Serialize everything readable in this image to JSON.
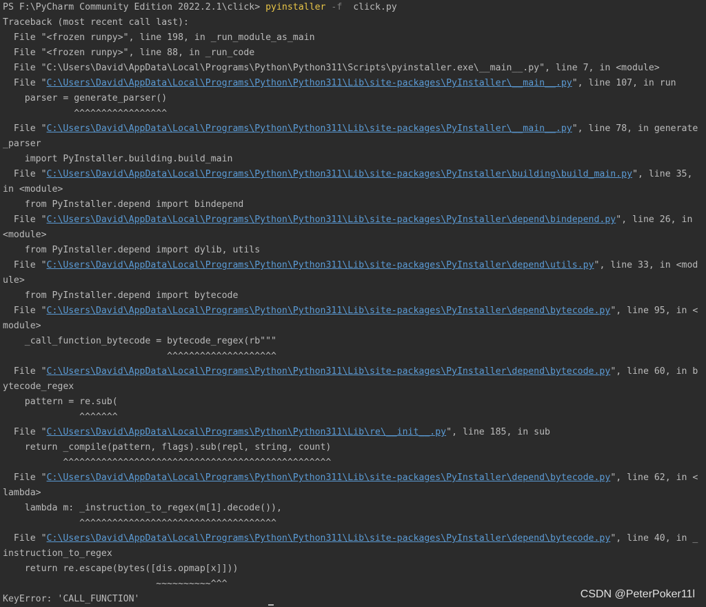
{
  "prompt": {
    "prefix": "PS F:\\PyCharm Community Edition 2022.2.1\\click> ",
    "command": "pyinstaller",
    "flag": "-f",
    "argument": "click.py"
  },
  "traceback_header": "Traceback (most recent call last):",
  "lines": {
    "l2": "  File \"<frozen runpy>\", line 198, in _run_module_as_main",
    "l3": "  File \"<frozen runpy>\", line 88, in _run_code",
    "l4": "  File \"C:\\Users\\David\\AppData\\Local\\Programs\\Python\\Python311\\Scripts\\pyinstaller.exe\\__main__.py\", line 7, in <module>",
    "l5_pre": "  File \"",
    "l5_link": "C:\\Users\\David\\AppData\\Local\\Programs\\Python\\Python311\\Lib\\site-packages\\PyInstaller\\__main__.py",
    "l5_post": "\", line 107, in run",
    "l6": "    parser = generate_parser()",
    "l7": "             ^^^^^^^^^^^^^^^^^",
    "l8_pre": "  File \"",
    "l8_link": "C:\\Users\\David\\AppData\\Local\\Programs\\Python\\Python311\\Lib\\site-packages\\PyInstaller\\__main__.py",
    "l8_post": "\", line 78, in generate",
    "l9": "_parser",
    "l10": "    import PyInstaller.building.build_main",
    "l11_pre": "  File \"",
    "l11_link": "C:\\Users\\David\\AppData\\Local\\Programs\\Python\\Python311\\Lib\\site-packages\\PyInstaller\\building\\build_main.py",
    "l11_post": "\", line 35,",
    "l12": "in <module>",
    "l13": "    from PyInstaller.depend import bindepend",
    "l14_pre": "  File \"",
    "l14_link": "C:\\Users\\David\\AppData\\Local\\Programs\\Python\\Python311\\Lib\\site-packages\\PyInstaller\\depend\\bindepend.py",
    "l14_post": "\", line 26, in",
    "l15": "<module>",
    "l16": "    from PyInstaller.depend import dylib, utils",
    "l17_pre": "  File \"",
    "l17_link": "C:\\Users\\David\\AppData\\Local\\Programs\\Python\\Python311\\Lib\\site-packages\\PyInstaller\\depend\\utils.py",
    "l17_post": "\", line 33, in <mod",
    "l18": "ule>",
    "l19": "    from PyInstaller.depend import bytecode",
    "l20_pre": "  File \"",
    "l20_link": "C:\\Users\\David\\AppData\\Local\\Programs\\Python\\Python311\\Lib\\site-packages\\PyInstaller\\depend\\bytecode.py",
    "l20_post": "\", line 95, in <",
    "l21": "module>",
    "l22": "    _call_function_bytecode = bytecode_regex(rb\"\"\"",
    "l23": "                              ^^^^^^^^^^^^^^^^^^^^",
    "l24_pre": "  File \"",
    "l24_link": "C:\\Users\\David\\AppData\\Local\\Programs\\Python\\Python311\\Lib\\site-packages\\PyInstaller\\depend\\bytecode.py",
    "l24_post": "\", line 60, in b",
    "l25": "ytecode_regex",
    "l26": "    pattern = re.sub(",
    "l27": "              ^^^^^^^",
    "l28_pre": "  File \"",
    "l28_link": "C:\\Users\\David\\AppData\\Local\\Programs\\Python\\Python311\\Lib\\re\\__init__.py",
    "l28_post": "\", line 185, in sub",
    "l29": "    return _compile(pattern, flags).sub(repl, string, count)",
    "l30": "           ^^^^^^^^^^^^^^^^^^^^^^^^^^^^^^^^^^^^^^^^^^^^^^^^^",
    "l31_pre": "  File \"",
    "l31_link": "C:\\Users\\David\\AppData\\Local\\Programs\\Python\\Python311\\Lib\\site-packages\\PyInstaller\\depend\\bytecode.py",
    "l31_post": "\", line 62, in <",
    "l32": "lambda>",
    "l33": "    lambda m: _instruction_to_regex(m[1].decode()),",
    "l34": "              ^^^^^^^^^^^^^^^^^^^^^^^^^^^^^^^^^^^^",
    "l35_pre": "  File \"",
    "l35_link": "C:\\Users\\David\\AppData\\Local\\Programs\\Python\\Python311\\Lib\\site-packages\\PyInstaller\\depend\\bytecode.py",
    "l35_post": "\", line 40, in _",
    "l36": "instruction_to_regex",
    "l37": "    return re.escape(bytes([dis.opmap[x]]))",
    "l38": "                            ~~~~~~~~~~^^^",
    "l39": "KeyError: 'CALL_FUNCTION'"
  },
  "watermark": "CSDN @PeterPoker11l",
  "colors": {
    "background": "#2b2b2b",
    "text": "#bbbbbb",
    "command": "#e8c547",
    "link": "#5b9bd5",
    "flag": "#808080"
  }
}
